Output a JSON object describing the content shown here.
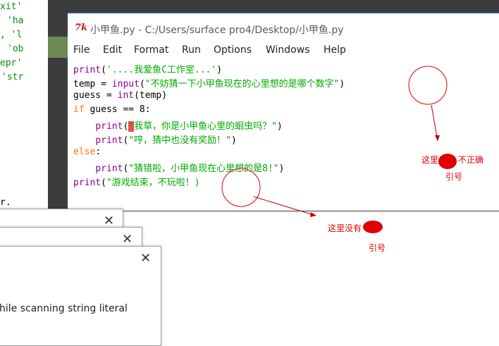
{
  "background_shell": {
    "lines": [
      "xit'",
      "'ha",
      ", 'l",
      "'ob",
      "epr'",
      "'str",
      "r."
    ]
  },
  "editor": {
    "icon_text": "7k",
    "title": "小甲鱼.py - C:/Users/surface pro4/Desktop/小甲鱼.py",
    "menu": [
      "File",
      "Edit",
      "Format",
      "Run",
      "Options",
      "Windows",
      "Help"
    ],
    "code": {
      "l1_fn": "print",
      "l1_a": "(",
      "l1_str": "'....我爱鱼C工作室...'",
      "l1_b": ")",
      "l2_a": "temp = ",
      "l2_fn": "input",
      "l2_b": "(",
      "l2_str": "\"不妨猜一下小甲鱼现在的心里想的是哪个数字\"",
      "l2_c": ")",
      "l3_a": "guess = ",
      "l3_fn": "int",
      "l3_b": "(temp)",
      "l4_kw": "if",
      "l4_a": " guess == 8:",
      "l5_indent": "    ",
      "l5_fn": "print",
      "l5_a": "(",
      "l5_mark": "\"",
      "l5_str": "我草，你是小甲鱼心里的蛔虫吗？\"",
      "l5_b": ")",
      "l6_indent": "    ",
      "l6_fn": "print",
      "l6_a": "(",
      "l6_str": "\"哼，猜中也没有奖励！\"",
      "l6_b": ")",
      "l7_kw": "else",
      "l7_a": ":",
      "l8_indent": "    ",
      "l8_fn": "print",
      "l8_a": "(",
      "l8_str": "\"猜错啦，小甲鱼现在心里想的是8!\"",
      "l8_b": ")",
      "l9_fn": "print",
      "l9_a": "(",
      "l9_str": "\"游戏结束，不玩啦！)",
      "l9_b": ""
    }
  },
  "dialogs": {
    "close_glyph": "✕",
    "message": "hile scanning string literal"
  },
  "annotations": {
    "note1_a": "这里",
    "note1_b": "不正确",
    "note1_c": "引号",
    "note2_a": "这里没有",
    "note2_c": "引号",
    "color": "#e00000"
  },
  "colors": {
    "keyword": "#ff7700",
    "builtin": "#900090",
    "string": "#00aa00",
    "title_accent": "#2b6cd6"
  }
}
